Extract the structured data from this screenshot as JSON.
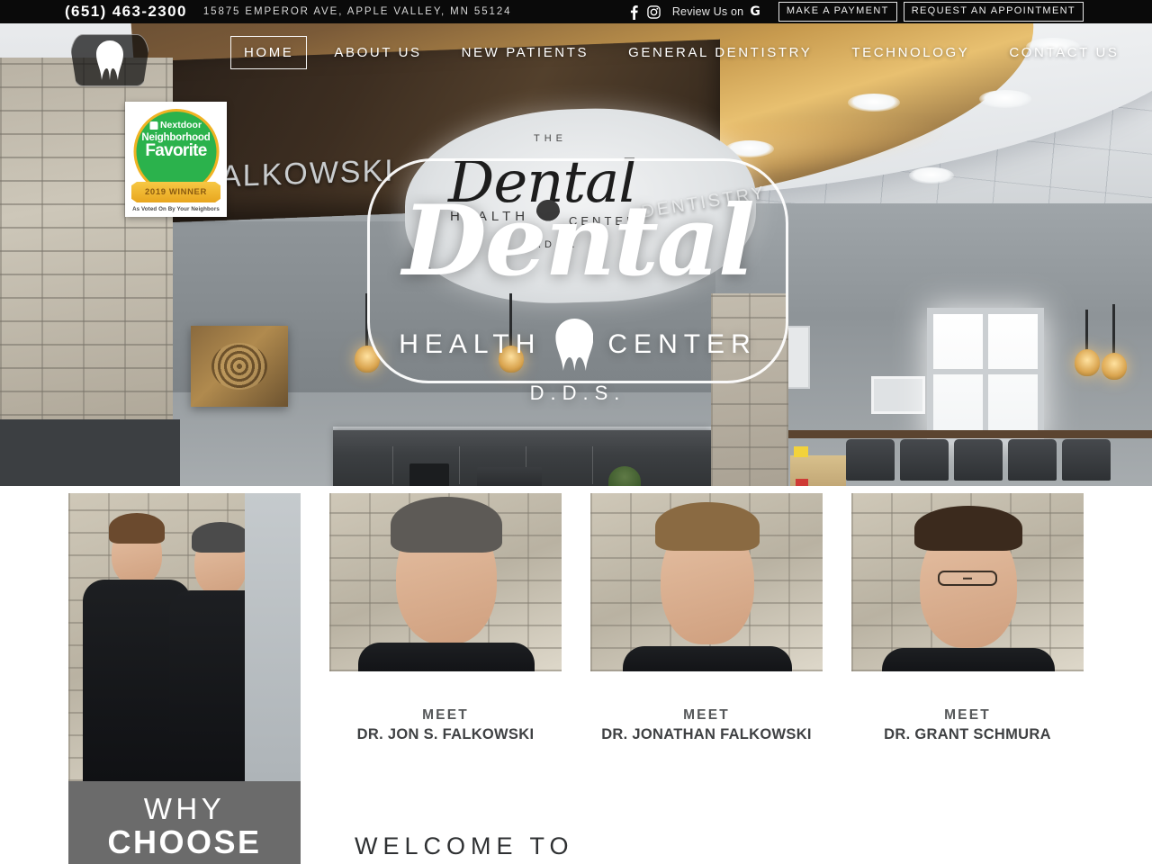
{
  "topbar": {
    "phone": "(651) 463-2300",
    "address": "15875 EMPEROR AVE, APPLE VALLEY, MN 55124",
    "facebook_icon": "facebook-icon",
    "instagram_icon": "instagram-icon",
    "review_text": "Review Us on",
    "google_icon": "G",
    "payment_button": "MAKE A PAYMENT",
    "appointment_button": "REQUEST AN APPOINTMENT"
  },
  "nav": {
    "logo_icon": "tooth-logo-icon",
    "items": [
      {
        "label": "HOME",
        "active": true
      },
      {
        "label": "ABOUT US",
        "active": false
      },
      {
        "label": "NEW PATIENTS",
        "active": false
      },
      {
        "label": "GENERAL DENTISTRY",
        "active": false
      },
      {
        "label": "TECHNOLOGY",
        "active": false
      },
      {
        "label": "CONTACT US",
        "active": false
      }
    ]
  },
  "badge": {
    "brand": "Nextdoor",
    "line1": "Neighborhood",
    "line2": "Favorite",
    "ribbon": "2019 WINNER",
    "footer": "As Voted On By Your Neighbors",
    "green": "#2bb24c",
    "gold": "#f0b323"
  },
  "hero": {
    "logo_script": "Dental",
    "logo_health": "HEALTH",
    "logo_center": "CENTER",
    "logo_dds": "D.D.S.",
    "logo_tooth_icon": "tooth-icon",
    "wall_sign_name": "ALKOWSKI",
    "wall_sign_dentistry": "DENTISTRY",
    "wall_sign_the": "THE",
    "wall_sign_script": "Dental",
    "wall_sign_health": "HEALTH",
    "wall_sign_center": "CENTER",
    "wall_sign_dds": "D.D.S."
  },
  "doctors": [
    {
      "meet": "",
      "name": "",
      "photo": "two-doctors-group-photo"
    },
    {
      "meet": "MEET",
      "name": "DR. JON S. FALKOWSKI",
      "photo": "portrait-jon-falkowski"
    },
    {
      "meet": "MEET",
      "name": "DR. JONATHAN FALKOWSKI",
      "photo": "portrait-jonathan-falkowski"
    },
    {
      "meet": "MEET",
      "name": "DR. GRANT SCHMURA",
      "photo": "portrait-grant-schmura"
    }
  ],
  "why_panel": {
    "line1": "WHY",
    "line2": "CHOOSE",
    "bg_color": "#6b6b6b"
  },
  "welcome": {
    "heading": "WELCOME TO"
  }
}
